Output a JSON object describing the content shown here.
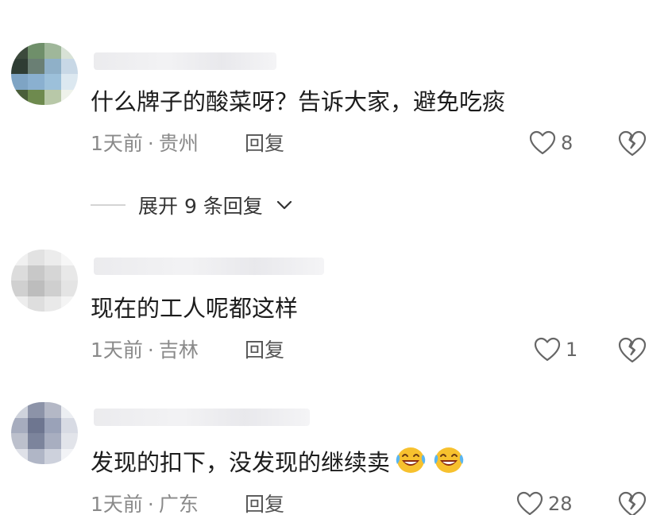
{
  "comments": [
    {
      "text": "什么牌子的酸菜呀？告诉大家，避免吃痰",
      "time": "1天前",
      "location": "贵州",
      "reply_label": "回复",
      "likes": "8",
      "expand_label": "展开 9 条回复"
    },
    {
      "text": "现在的工人呢都这样",
      "time": "1天前",
      "location": "吉林",
      "reply_label": "回复",
      "likes": "1"
    },
    {
      "text": "发现的扣下，没发现的继续卖",
      "emoji": "laughing-crying-emoji",
      "time": "1天前",
      "location": "广东",
      "reply_label": "回复",
      "likes": "28"
    }
  ],
  "separator": "·",
  "colors": {
    "meta_gray": "#8a8a8a",
    "text": "#1c1c1c",
    "icon": "#666666"
  }
}
